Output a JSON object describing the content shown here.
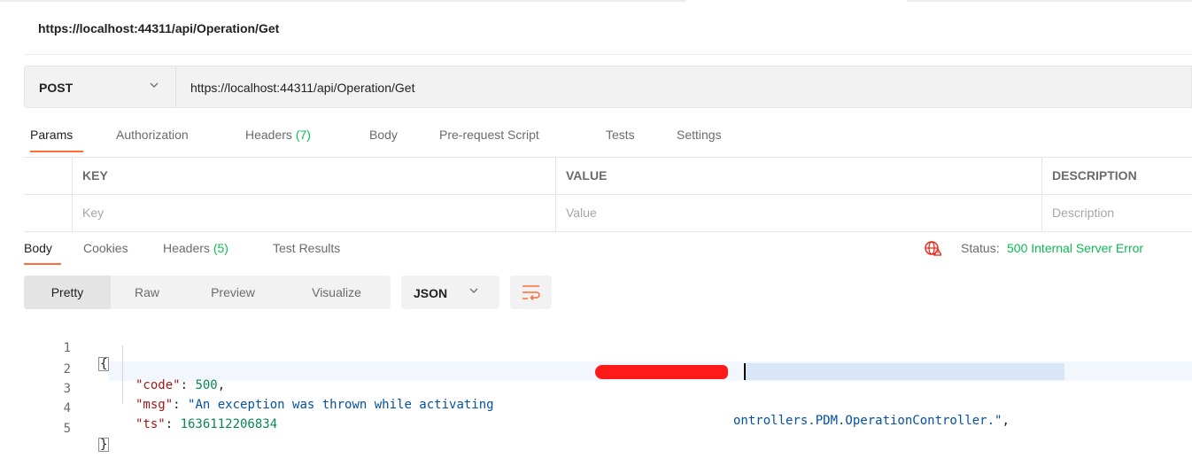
{
  "request": {
    "title": "https://localhost:44311/api/Operation/Get",
    "method": "POST",
    "method_chevron": "chevron-down-icon",
    "url": "https://localhost:44311/api/Operation/Get"
  },
  "request_tabs": [
    {
      "label": "Params",
      "count": ""
    },
    {
      "label": "Authorization",
      "count": ""
    },
    {
      "label": "Headers",
      "count": "(7)"
    },
    {
      "label": "Body",
      "count": ""
    },
    {
      "label": "Pre-request Script",
      "count": ""
    },
    {
      "label": "Tests",
      "count": ""
    },
    {
      "label": "Settings",
      "count": ""
    }
  ],
  "params_table": {
    "headers": [
      "KEY",
      "VALUE",
      "DESCRIPTION"
    ],
    "placeholders": [
      "Key",
      "Value",
      "Description"
    ]
  },
  "response_tabs": [
    {
      "label": "Body",
      "count": ""
    },
    {
      "label": "Cookies",
      "count": ""
    },
    {
      "label": "Headers",
      "count": "(5)"
    },
    {
      "label": "Test Results",
      "count": ""
    }
  ],
  "status": {
    "icon": "globe-error-icon",
    "label": "Status:",
    "value": "500 Internal Server Error"
  },
  "view_modes": [
    "Pretty",
    "Raw",
    "Preview",
    "Visualize"
  ],
  "format": {
    "label": "JSON",
    "icon": "chevron-down-icon"
  },
  "wrap_icon": "wrap-lines-icon",
  "code": {
    "line_numbers": [
      "1",
      "2",
      "3",
      "4",
      "5"
    ],
    "open_brace": "{",
    "close_brace": "}",
    "code_key": "\"code\"",
    "code_value": "500",
    "msg_key": "\"msg\"",
    "msg_value_before": "\"An exception was thrown while activating ",
    "msg_value_after": "ontrollers.PDM.OperationController.\"",
    "ts_key": "\"ts\"",
    "ts_value": "1636112206834"
  },
  "colors": {
    "accent": "#ff6c37",
    "success": "#0cbb52",
    "error": "#eb2013"
  }
}
